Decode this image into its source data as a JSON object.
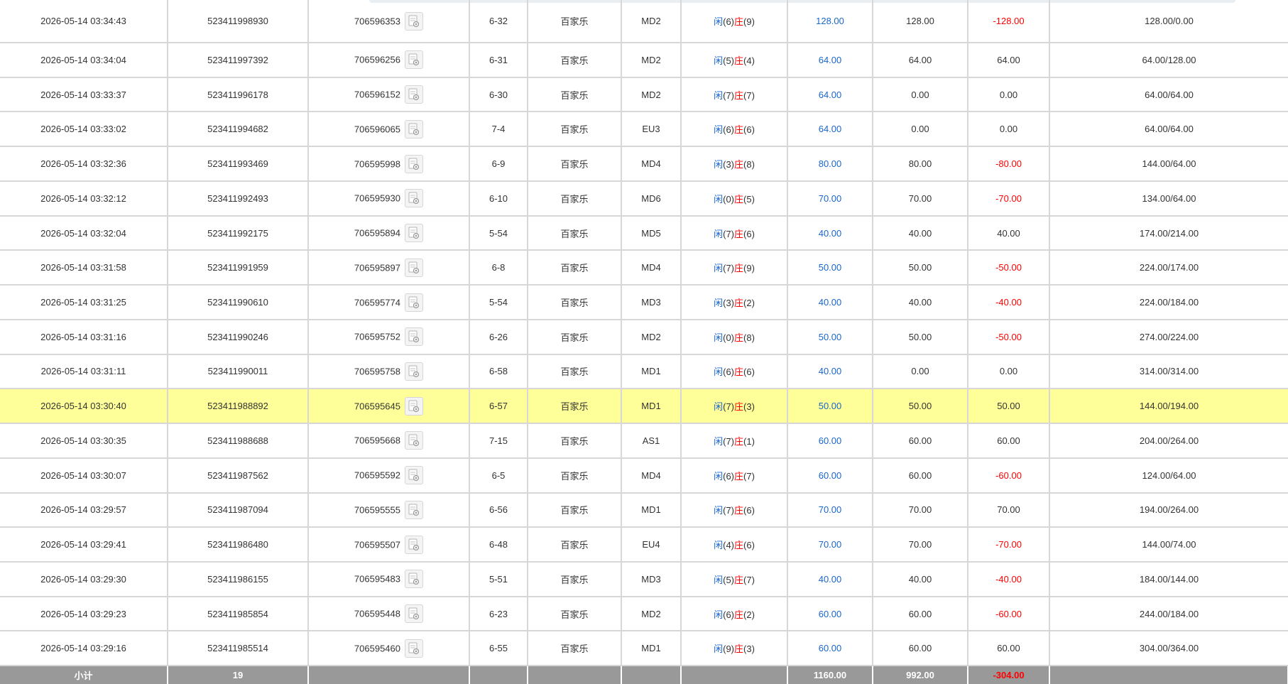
{
  "rows": [
    {
      "time": "2026-05-14 03:34:43",
      "bet_id": "523411998930",
      "round": "706596353",
      "table": "6-32",
      "game": "百家乐",
      "dealer": "MD2",
      "player": "闲",
      "player_pts": "(6)",
      "banker": "庄",
      "banker_pts": "(9)",
      "bet": "128.00",
      "valid": "128.00",
      "win": "-128.00",
      "balance": "128.00/0.00",
      "highlight": false
    },
    {
      "time": "2026-05-14 03:34:04",
      "bet_id": "523411997392",
      "round": "706596256",
      "table": "6-31",
      "game": "百家乐",
      "dealer": "MD2",
      "player": "闲",
      "player_pts": "(5)",
      "banker": "庄",
      "banker_pts": "(4)",
      "bet": "64.00",
      "valid": "64.00",
      "win": "64.00",
      "balance": "64.00/128.00",
      "highlight": false
    },
    {
      "time": "2026-05-14 03:33:37",
      "bet_id": "523411996178",
      "round": "706596152",
      "table": "6-30",
      "game": "百家乐",
      "dealer": "MD2",
      "player": "闲",
      "player_pts": "(7)",
      "banker": "庄",
      "banker_pts": "(7)",
      "bet": "64.00",
      "valid": "0.00",
      "win": "0.00",
      "balance": "64.00/64.00",
      "highlight": false
    },
    {
      "time": "2026-05-14 03:33:02",
      "bet_id": "523411994682",
      "round": "706596065",
      "table": "7-4",
      "game": "百家乐",
      "dealer": "EU3",
      "player": "闲",
      "player_pts": "(6)",
      "banker": "庄",
      "banker_pts": "(6)",
      "bet": "64.00",
      "valid": "0.00",
      "win": "0.00",
      "balance": "64.00/64.00",
      "highlight": false
    },
    {
      "time": "2026-05-14 03:32:36",
      "bet_id": "523411993469",
      "round": "706595998",
      "table": "6-9",
      "game": "百家乐",
      "dealer": "MD4",
      "player": "闲",
      "player_pts": "(3)",
      "banker": "庄",
      "banker_pts": "(8)",
      "bet": "80.00",
      "valid": "80.00",
      "win": "-80.00",
      "balance": "144.00/64.00",
      "highlight": false
    },
    {
      "time": "2026-05-14 03:32:12",
      "bet_id": "523411992493",
      "round": "706595930",
      "table": "6-10",
      "game": "百家乐",
      "dealer": "MD6",
      "player": "闲",
      "player_pts": "(0)",
      "banker": "庄",
      "banker_pts": "(5)",
      "bet": "70.00",
      "valid": "70.00",
      "win": "-70.00",
      "balance": "134.00/64.00",
      "highlight": false
    },
    {
      "time": "2026-05-14 03:32:04",
      "bet_id": "523411992175",
      "round": "706595894",
      "table": "5-54",
      "game": "百家乐",
      "dealer": "MD5",
      "player": "闲",
      "player_pts": "(7)",
      "banker": "庄",
      "banker_pts": "(6)",
      "bet": "40.00",
      "valid": "40.00",
      "win": "40.00",
      "balance": "174.00/214.00",
      "highlight": false
    },
    {
      "time": "2026-05-14 03:31:58",
      "bet_id": "523411991959",
      "round": "706595897",
      "table": "6-8",
      "game": "百家乐",
      "dealer": "MD4",
      "player": "闲",
      "player_pts": "(7)",
      "banker": "庄",
      "banker_pts": "(9)",
      "bet": "50.00",
      "valid": "50.00",
      "win": "-50.00",
      "balance": "224.00/174.00",
      "highlight": false
    },
    {
      "time": "2026-05-14 03:31:25",
      "bet_id": "523411990610",
      "round": "706595774",
      "table": "5-54",
      "game": "百家乐",
      "dealer": "MD3",
      "player": "闲",
      "player_pts": "(3)",
      "banker": "庄",
      "banker_pts": "(2)",
      "bet": "40.00",
      "valid": "40.00",
      "win": "-40.00",
      "balance": "224.00/184.00",
      "highlight": false
    },
    {
      "time": "2026-05-14 03:31:16",
      "bet_id": "523411990246",
      "round": "706595752",
      "table": "6-26",
      "game": "百家乐",
      "dealer": "MD2",
      "player": "闲",
      "player_pts": "(0)",
      "banker": "庄",
      "banker_pts": "(8)",
      "bet": "50.00",
      "valid": "50.00",
      "win": "-50.00",
      "balance": "274.00/224.00",
      "highlight": false
    },
    {
      "time": "2026-05-14 03:31:11",
      "bet_id": "523411990011",
      "round": "706595758",
      "table": "6-58",
      "game": "百家乐",
      "dealer": "MD1",
      "player": "闲",
      "player_pts": "(6)",
      "banker": "庄",
      "banker_pts": "(6)",
      "bet": "40.00",
      "valid": "0.00",
      "win": "0.00",
      "balance": "314.00/314.00",
      "highlight": false
    },
    {
      "time": "2026-05-14 03:30:40",
      "bet_id": "523411988892",
      "round": "706595645",
      "table": "6-57",
      "game": "百家乐",
      "dealer": "MD1",
      "player": "闲",
      "player_pts": "(7)",
      "banker": "庄",
      "banker_pts": "(3)",
      "bet": "50.00",
      "valid": "50.00",
      "win": "50.00",
      "balance": "144.00/194.00",
      "highlight": true
    },
    {
      "time": "2026-05-14 03:30:35",
      "bet_id": "523411988688",
      "round": "706595668",
      "table": "7-15",
      "game": "百家乐",
      "dealer": "AS1",
      "player": "闲",
      "player_pts": "(7)",
      "banker": "庄",
      "banker_pts": "(1)",
      "bet": "60.00",
      "valid": "60.00",
      "win": "60.00",
      "balance": "204.00/264.00",
      "highlight": false
    },
    {
      "time": "2026-05-14 03:30:07",
      "bet_id": "523411987562",
      "round": "706595592",
      "table": "6-5",
      "game": "百家乐",
      "dealer": "MD4",
      "player": "闲",
      "player_pts": "(6)",
      "banker": "庄",
      "banker_pts": "(7)",
      "bet": "60.00",
      "valid": "60.00",
      "win": "-60.00",
      "balance": "124.00/64.00",
      "highlight": false
    },
    {
      "time": "2026-05-14 03:29:57",
      "bet_id": "523411987094",
      "round": "706595555",
      "table": "6-56",
      "game": "百家乐",
      "dealer": "MD1",
      "player": "闲",
      "player_pts": "(7)",
      "banker": "庄",
      "banker_pts": "(6)",
      "bet": "70.00",
      "valid": "70.00",
      "win": "70.00",
      "balance": "194.00/264.00",
      "highlight": false
    },
    {
      "time": "2026-05-14 03:29:41",
      "bet_id": "523411986480",
      "round": "706595507",
      "table": "6-48",
      "game": "百家乐",
      "dealer": "EU4",
      "player": "闲",
      "player_pts": "(4)",
      "banker": "庄",
      "banker_pts": "(6)",
      "bet": "70.00",
      "valid": "70.00",
      "win": "-70.00",
      "balance": "144.00/74.00",
      "highlight": false
    },
    {
      "time": "2026-05-14 03:29:30",
      "bet_id": "523411986155",
      "round": "706595483",
      "table": "5-51",
      "game": "百家乐",
      "dealer": "MD3",
      "player": "闲",
      "player_pts": "(5)",
      "banker": "庄",
      "banker_pts": "(7)",
      "bet": "40.00",
      "valid": "40.00",
      "win": "-40.00",
      "balance": "184.00/144.00",
      "highlight": false
    },
    {
      "time": "2026-05-14 03:29:23",
      "bet_id": "523411985854",
      "round": "706595448",
      "table": "6-23",
      "game": "百家乐",
      "dealer": "MD2",
      "player": "闲",
      "player_pts": "(6)",
      "banker": "庄",
      "banker_pts": "(2)",
      "bet": "60.00",
      "valid": "60.00",
      "win": "-60.00",
      "balance": "244.00/184.00",
      "highlight": false
    },
    {
      "time": "2026-05-14 03:29:16",
      "bet_id": "523411985514",
      "round": "706595460",
      "table": "6-55",
      "game": "百家乐",
      "dealer": "MD1",
      "player": "闲",
      "player_pts": "(9)",
      "banker": "庄",
      "banker_pts": "(3)",
      "bet": "60.00",
      "valid": "60.00",
      "win": "60.00",
      "balance": "304.00/364.00",
      "highlight": false
    }
  ],
  "subtotal": {
    "label": "小计",
    "count": "19",
    "bet": "1160.00",
    "valid": "992.00",
    "win": "-304.00"
  },
  "colors": {
    "highlight_row": "#ffff99",
    "negative": "#ff0000",
    "bet_amount": "#1a66cc",
    "subtotal_bg": "#999999"
  },
  "icons": {
    "round_detail": "round-detail-icon"
  }
}
